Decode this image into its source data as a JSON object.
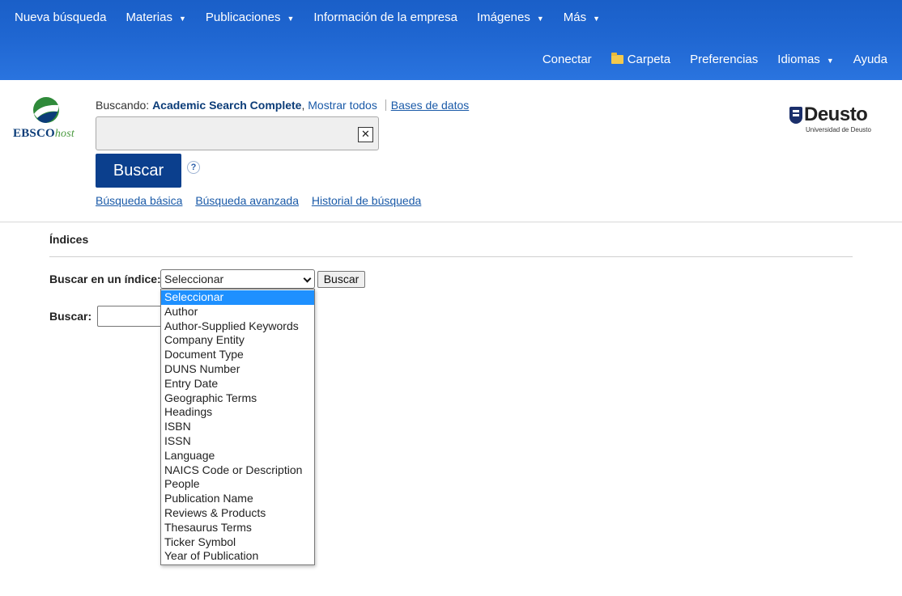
{
  "topnav": {
    "items": [
      {
        "label": "Nueva búsqueda",
        "caret": false
      },
      {
        "label": "Materias",
        "caret": true
      },
      {
        "label": "Publicaciones",
        "caret": true
      },
      {
        "label": "Información de la empresa",
        "caret": false
      },
      {
        "label": "Imágenes",
        "caret": true
      },
      {
        "label": "Más",
        "caret": true
      }
    ],
    "caret_glyph": "▼"
  },
  "usernav": {
    "connect": "Conectar",
    "folder": "Carpeta",
    "preferences": "Preferencias",
    "languages": "Idiomas",
    "help": "Ayuda"
  },
  "logo": {
    "ebsco": "EBSCO",
    "host": "host",
    "deusto": "Deusto",
    "deusto_sub": "Universidad de Deusto"
  },
  "search": {
    "searching_label": "Buscando:",
    "database": "Academic Search Complete",
    "show_all": "Mostrar todos",
    "databases": "Bases de datos",
    "input_value": "",
    "clear_glyph": "✕",
    "button": "Buscar",
    "help_glyph": "?",
    "links": [
      "Búsqueda básica",
      "Búsqueda avanzada",
      "Historial de búsqueda"
    ]
  },
  "indices": {
    "title": "Índices",
    "index_label": "Buscar en un índice:",
    "selected": "Seleccionar",
    "go_button": "Buscar",
    "find_label": "Buscar:",
    "options": [
      "Seleccionar",
      "Author",
      "Author-Supplied Keywords",
      "Company Entity",
      "Document Type",
      "DUNS Number",
      "Entry Date",
      "Geographic Terms",
      "Headings",
      "ISBN",
      "ISSN",
      "Language",
      "NAICS Code or Description",
      "People",
      "Publication Name",
      "Reviews & Products",
      "Thesaurus Terms",
      "Ticker Symbol",
      "Year of Publication"
    ]
  },
  "colors": {
    "topbar": "#1f66d1",
    "primary_button": "#0b3f8d",
    "link": "#1a5aa8",
    "selected_option": "#1e90ff"
  }
}
